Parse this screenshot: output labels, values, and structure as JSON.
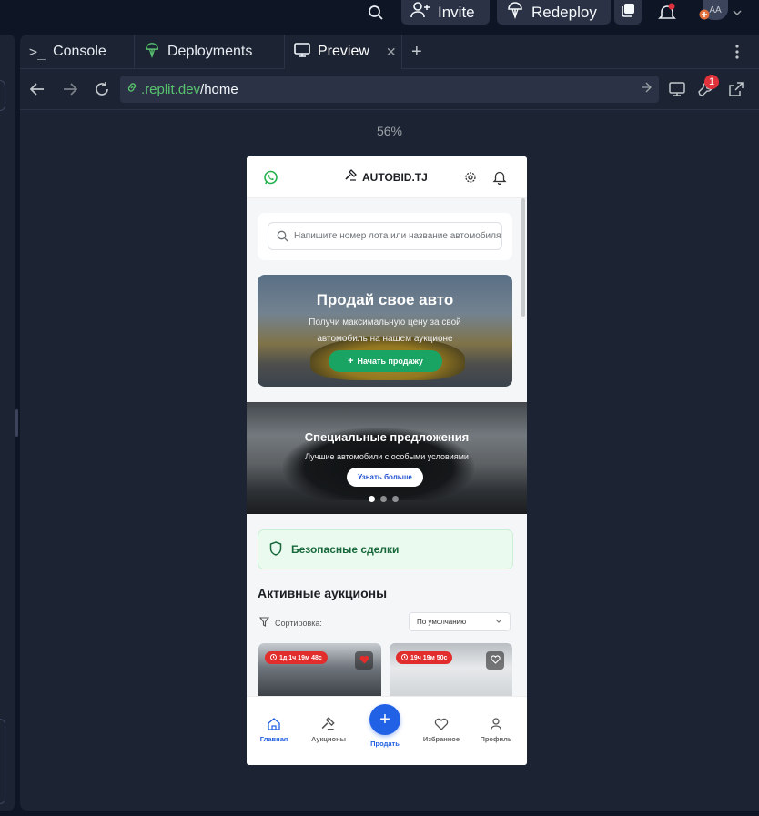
{
  "topbar": {
    "invite_label": "Invite",
    "redeploy_label": "Redeploy",
    "avatar_initials": "AA"
  },
  "tabs": [
    {
      "label": "Console",
      "icon": "terminal-icon"
    },
    {
      "label": "Deployments",
      "icon": "deploy-icon"
    },
    {
      "label": "Preview",
      "icon": "monitor-icon",
      "active": true
    }
  ],
  "browser": {
    "url_domain": ".replit.dev",
    "url_path": "/home",
    "devtools_badge": "1",
    "zoom": "56%"
  },
  "app": {
    "brand": "AUTOBID.TJ",
    "search_placeholder": "Напишите номер лота или название автомобиля",
    "promo": {
      "title": "Продай свое авто",
      "subtitle": "Получи максимальную цену за свой автомобиль на нашем аукционе",
      "button": "Начать продажу"
    },
    "special": {
      "title": "Специальные предложения",
      "subtitle": "Лучшие автомобили с особыми условиями",
      "button": "Узнать больше"
    },
    "safe_deals": "Безопасные сделки",
    "active_auctions_title": "Активные аукционы",
    "sort_label": "Сортировка:",
    "sort_value": "По умолчанию",
    "cards": [
      {
        "timer": "1д 1ч 19м 48с",
        "favorited": true
      },
      {
        "timer": "19ч 19м 50с",
        "favorited": false
      }
    ],
    "bottom_nav": {
      "home": "Главная",
      "auctions": "Аукционы",
      "sell": "Продать",
      "favorites": "Избранное",
      "profile": "Профиль"
    }
  },
  "colors": {
    "accent_blue": "#2161e5",
    "accent_green": "#19a463",
    "timer_red": "#e22d2d",
    "url_green": "#58c26e"
  }
}
